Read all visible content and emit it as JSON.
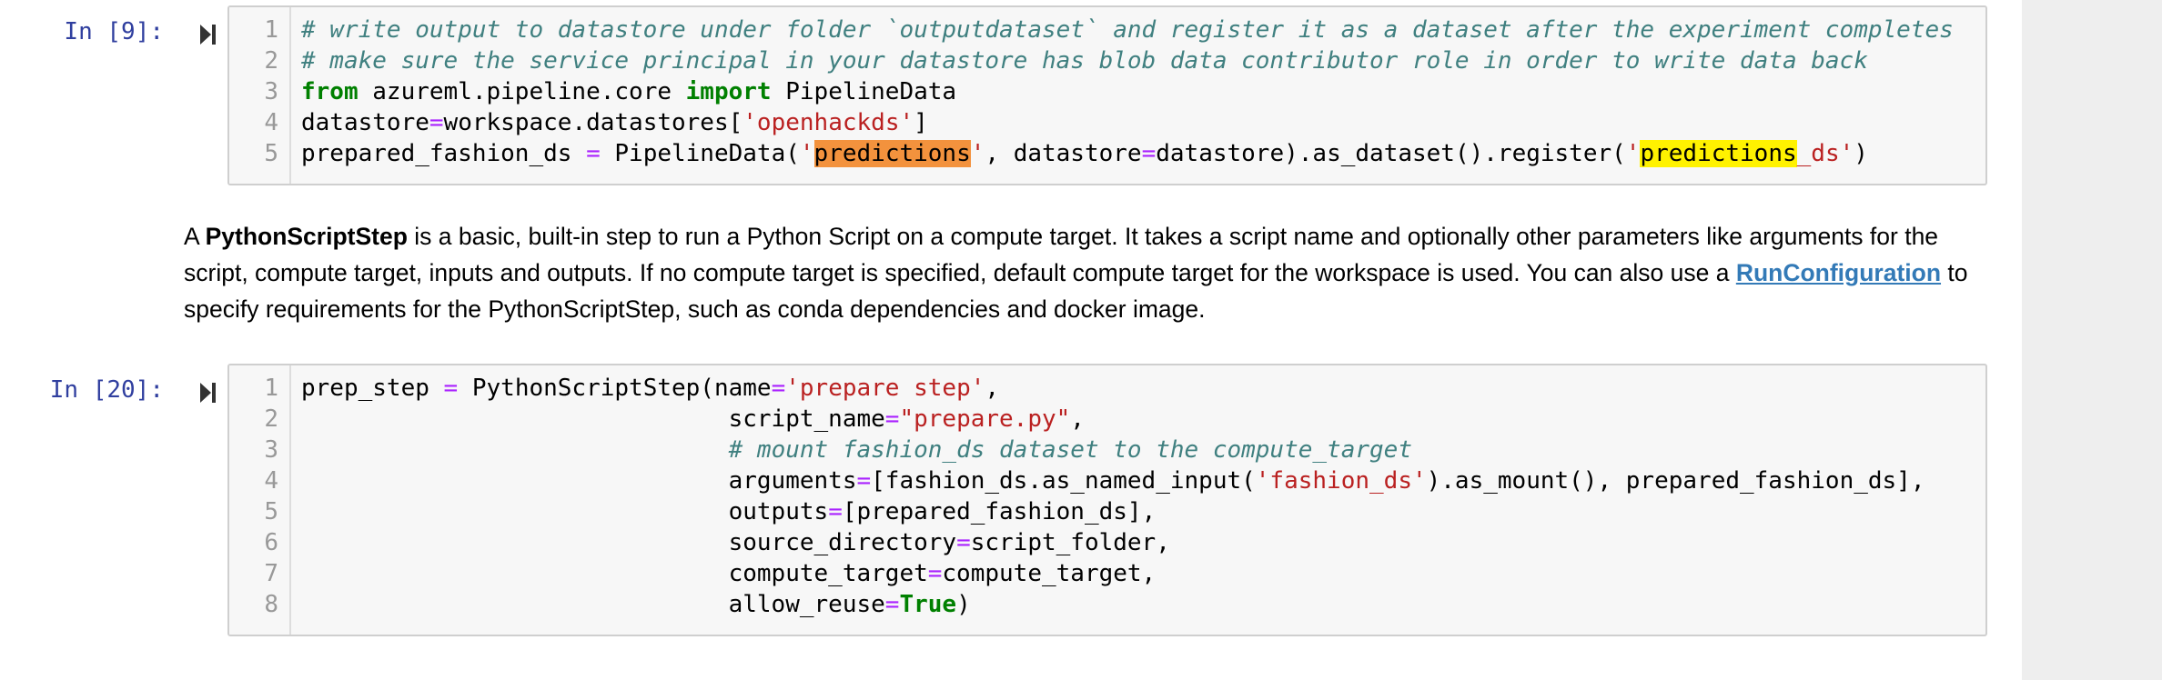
{
  "cell1": {
    "prompt": "In [9]:",
    "lines": [
      {
        "n": "1",
        "parts": [
          {
            "t": "# write output to datastore under folder `outputdataset` and register it as a dataset after the experiment completes",
            "c": "cm"
          }
        ]
      },
      {
        "n": "2",
        "parts": [
          {
            "t": "# make sure the service principal in your datastore has blob data contributor role in order to write data back",
            "c": "cm"
          }
        ]
      },
      {
        "n": "3",
        "parts": [
          {
            "t": "from",
            "c": "kw"
          },
          {
            "t": " azureml.pipeline.core ",
            "c": ""
          },
          {
            "t": "import",
            "c": "kw"
          },
          {
            "t": " PipelineData",
            "c": ""
          }
        ]
      },
      {
        "n": "4",
        "parts": [
          {
            "t": "datastore",
            "c": ""
          },
          {
            "t": "=",
            "c": "op"
          },
          {
            "t": "workspace.datastores[",
            "c": ""
          },
          {
            "t": "'openhackds'",
            "c": "st"
          },
          {
            "t": "]",
            "c": ""
          }
        ]
      },
      {
        "n": "5",
        "parts": [
          {
            "t": "prepared_fashion_ds ",
            "c": ""
          },
          {
            "t": "=",
            "c": "op"
          },
          {
            "t": " PipelineData(",
            "c": ""
          },
          {
            "t": "'",
            "c": "st"
          },
          {
            "t": "predictions",
            "c": "hl-orange"
          },
          {
            "t": "'",
            "c": "st"
          },
          {
            "t": ", datastore",
            "c": ""
          },
          {
            "t": "=",
            "c": "op"
          },
          {
            "t": "datastore).as_dataset().register(",
            "c": ""
          },
          {
            "t": "'",
            "c": "st"
          },
          {
            "t": "predictions",
            "c": "hl-yellow"
          },
          {
            "t": "_ds'",
            "c": "st"
          },
          {
            "t": ")",
            "c": ""
          }
        ]
      }
    ]
  },
  "markdown": {
    "p1": "A ",
    "bold": "PythonScriptStep",
    "p2": " is a basic, built-in step to run a Python Script on a compute target. It takes a script name and optionally other parameters like arguments for the script, compute target, inputs and outputs. If no compute target is specified, default compute target for the workspace is used. You can also use a ",
    "link": "RunConfiguration",
    "p3": " to specify requirements for the PythonScriptStep, such as conda dependencies and docker image."
  },
  "cell2": {
    "prompt": "In [20]:",
    "lines": [
      {
        "n": "1",
        "parts": [
          {
            "t": "prep_step ",
            "c": ""
          },
          {
            "t": "=",
            "c": "op"
          },
          {
            "t": " PythonScriptStep(name",
            "c": ""
          },
          {
            "t": "=",
            "c": "op"
          },
          {
            "t": "'prepare step'",
            "c": "st"
          },
          {
            "t": ",",
            "c": ""
          }
        ]
      },
      {
        "n": "2",
        "parts": [
          {
            "t": "                              script_name",
            "c": ""
          },
          {
            "t": "=",
            "c": "op"
          },
          {
            "t": "\"prepare.py\"",
            "c": "st"
          },
          {
            "t": ",",
            "c": ""
          }
        ]
      },
      {
        "n": "3",
        "parts": [
          {
            "t": "                              ",
            "c": ""
          },
          {
            "t": "# mount fashion_ds dataset to the compute_target",
            "c": "cm"
          }
        ]
      },
      {
        "n": "4",
        "parts": [
          {
            "t": "                              arguments",
            "c": ""
          },
          {
            "t": "=",
            "c": "op"
          },
          {
            "t": "[fashion_ds.as_named_input(",
            "c": ""
          },
          {
            "t": "'fashion_ds'",
            "c": "st"
          },
          {
            "t": ").as_mount(), prepared_fashion_ds],",
            "c": ""
          }
        ]
      },
      {
        "n": "5",
        "parts": [
          {
            "t": "                              outputs",
            "c": ""
          },
          {
            "t": "=",
            "c": "op"
          },
          {
            "t": "[prepared_fashion_ds],",
            "c": ""
          }
        ]
      },
      {
        "n": "6",
        "parts": [
          {
            "t": "                              source_directory",
            "c": ""
          },
          {
            "t": "=",
            "c": "op"
          },
          {
            "t": "script_folder,",
            "c": ""
          }
        ]
      },
      {
        "n": "7",
        "parts": [
          {
            "t": "                              compute_target",
            "c": ""
          },
          {
            "t": "=",
            "c": "op"
          },
          {
            "t": "compute_target,",
            "c": ""
          }
        ]
      },
      {
        "n": "8",
        "parts": [
          {
            "t": "                              allow_reuse",
            "c": ""
          },
          {
            "t": "=",
            "c": "op"
          },
          {
            "t": "True",
            "c": "kw"
          },
          {
            "t": ")",
            "c": ""
          }
        ]
      }
    ]
  },
  "icons": {
    "run": "run-cell-icon"
  }
}
